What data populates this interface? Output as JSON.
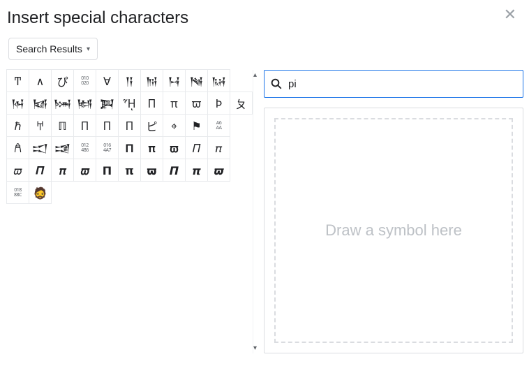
{
  "title": "Insert special characters",
  "category": {
    "label": "Search Results"
  },
  "search": {
    "value": "pi",
    "placeholder": ""
  },
  "draw_placeholder": "Draw a symbol here",
  "grid": [
    [
      "Ͳ",
      "∧",
      "ぴ",
      "010\n020",
      "∀",
      "𒀀",
      "𒀁",
      "𒀂",
      "𒀃",
      "𒀄"
    ],
    [
      "𒀅",
      "𒀆",
      "𒀇",
      "𒀈",
      "𒀉",
      "ᾟ",
      "П",
      "π",
      "ϖ",
      "Þ",
      "ㄆ"
    ],
    [
      "ℏ",
      "𐀀",
      "ℿ",
      "Π",
      "Π",
      "Π",
      "ピ",
      "⌖",
      "⚑",
      "A6\nAA"
    ],
    [
      "𐀁",
      "𒀊",
      "𒀋",
      "012\n486",
      "016\n4A7",
      "𝚷",
      "𝛑",
      "𝛡",
      "𝛱",
      "𝜋"
    ],
    [
      "𝜛",
      "𝜫",
      "𝝅",
      "𝝕",
      "𝝥",
      "𝝿",
      "𝞏",
      "𝞟",
      "𝞹",
      "𝟉"
    ],
    [
      "018\n88C",
      "🧔"
    ]
  ]
}
